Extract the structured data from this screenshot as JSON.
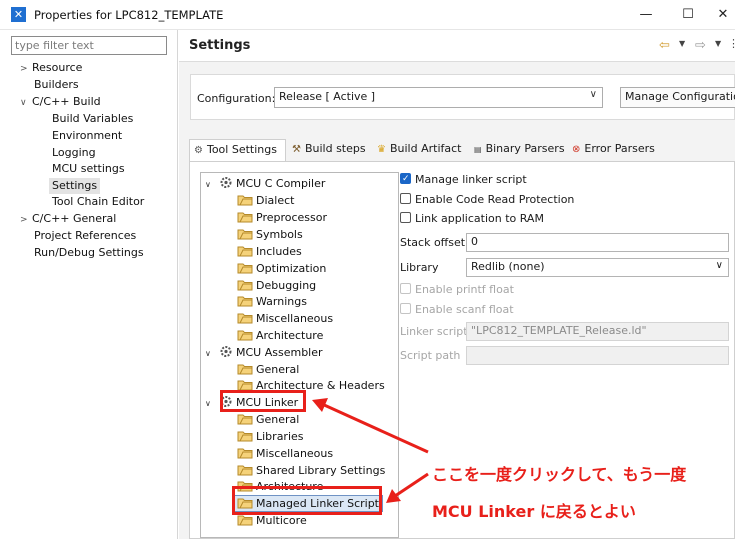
{
  "window": {
    "title": "Properties for LPC812_TEMPLATE",
    "app_icon": "eclipse-x-icon"
  },
  "left_nav": {
    "filter_placeholder": "type filter text",
    "items": [
      {
        "label": "Resource",
        "expandable": true,
        "expanded": false
      },
      {
        "label": "Builders"
      },
      {
        "label": "C/C++ Build",
        "expandable": true,
        "expanded": true
      },
      {
        "label": "Build Variables"
      },
      {
        "label": "Environment"
      },
      {
        "label": "Logging"
      },
      {
        "label": "MCU settings"
      },
      {
        "label": "Settings",
        "selected": true
      },
      {
        "label": "Tool Chain Editor"
      },
      {
        "label": "C/C++ General",
        "expandable": true,
        "expanded": false
      },
      {
        "label": "Project References"
      },
      {
        "label": "Run/Debug Settings"
      }
    ]
  },
  "page": {
    "title": "Settings"
  },
  "configuration": {
    "label": "Configuration:",
    "value": "Release  [ Active ]",
    "manage_label": "Manage Configurations..."
  },
  "tabs": [
    {
      "label": "Tool Settings",
      "icon": "gear-icon",
      "active": true
    },
    {
      "label": "Build steps",
      "icon": "hammer-icon"
    },
    {
      "label": "Build Artifact",
      "icon": "trophy-icon"
    },
    {
      "label": "Binary Parsers",
      "icon": "binary-icon"
    },
    {
      "label": "Error Parsers",
      "icon": "error-icon"
    }
  ],
  "tool_tree": [
    {
      "label": "MCU C Compiler",
      "type": "tool",
      "expanded": true
    },
    {
      "label": "Dialect",
      "type": "option"
    },
    {
      "label": "Preprocessor",
      "type": "option"
    },
    {
      "label": "Symbols",
      "type": "option"
    },
    {
      "label": "Includes",
      "type": "option"
    },
    {
      "label": "Optimization",
      "type": "option"
    },
    {
      "label": "Debugging",
      "type": "option"
    },
    {
      "label": "Warnings",
      "type": "option"
    },
    {
      "label": "Miscellaneous",
      "type": "option"
    },
    {
      "label": "Architecture",
      "type": "option"
    },
    {
      "label": "MCU Assembler",
      "type": "tool",
      "expanded": true
    },
    {
      "label": "General",
      "type": "option"
    },
    {
      "label": "Architecture & Headers",
      "type": "option"
    },
    {
      "label": "MCU Linker",
      "type": "tool",
      "expanded": true
    },
    {
      "label": "General",
      "type": "option"
    },
    {
      "label": "Libraries",
      "type": "option"
    },
    {
      "label": "Miscellaneous",
      "type": "option"
    },
    {
      "label": "Shared Library Settings",
      "type": "option"
    },
    {
      "label": "Architecture",
      "type": "option"
    },
    {
      "label": "Managed Linker Script",
      "type": "option",
      "selected": true
    },
    {
      "label": "Multicore",
      "type": "option"
    }
  ],
  "linker_settings": {
    "manage_linker_script": {
      "label": "Manage linker script",
      "checked": true
    },
    "enable_crp": {
      "label": "Enable Code Read Protection",
      "checked": false
    },
    "link_to_ram": {
      "label": "Link application to RAM",
      "checked": false
    },
    "stack_offset": {
      "label": "Stack offset",
      "value": "0"
    },
    "library": {
      "label": "Library",
      "value": "Redlib (none)"
    },
    "enable_printf_float": {
      "label": "Enable printf float",
      "checked": false,
      "disabled": true
    },
    "enable_scanf_float": {
      "label": "Enable scanf float",
      "checked": false,
      "disabled": true
    },
    "linker_script": {
      "label": "Linker script",
      "value": "\"LPC812_TEMPLATE_Release.ld\"",
      "disabled": true
    },
    "script_path": {
      "label": "Script path",
      "value": "",
      "disabled": true
    }
  },
  "annotation": {
    "line1": "ここを一度クリックして、もう一度",
    "line2": "MCU Linker に戻るとよい",
    "color": "#e8201a"
  }
}
